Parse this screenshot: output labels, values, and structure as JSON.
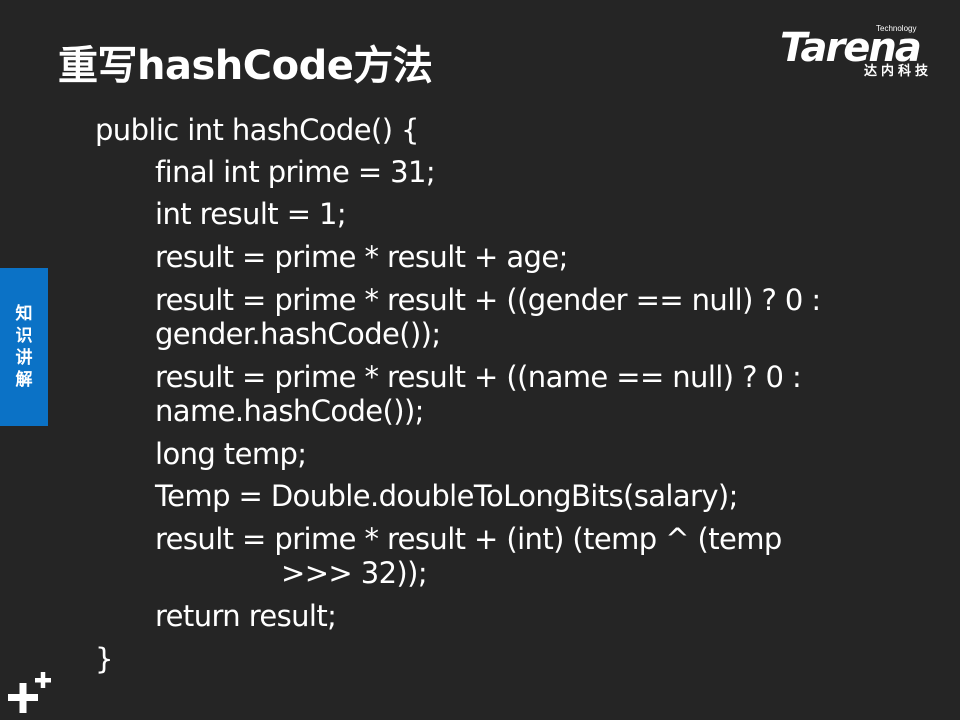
{
  "slide": {
    "title": "重写hashCode方法",
    "side_tab_label": "知识讲解"
  },
  "logo": {
    "word": "Tarena",
    "tagline": "Technology",
    "cn_text": "达内科技"
  },
  "code_lines": [
    "public int hashCode() {",
    "final int prime = 31;",
    "int result = 1;",
    "result = prime * result + age;",
    "result = prime * result + ((gender == null) ? 0 :",
    "gender.hashCode());",
    "result = prime * result + ((name == null) ? 0 :",
    "name.hashCode());",
    "long temp;",
    "Temp = Double.doubleToLongBits(salary);",
    "result = prime * result + (int) (temp ^ (temp",
    ">>> 32));",
    "return result;",
    "}"
  ],
  "colors": {
    "background": "#252525",
    "text": "#ffffff",
    "side_tab": "#0b72c6"
  }
}
